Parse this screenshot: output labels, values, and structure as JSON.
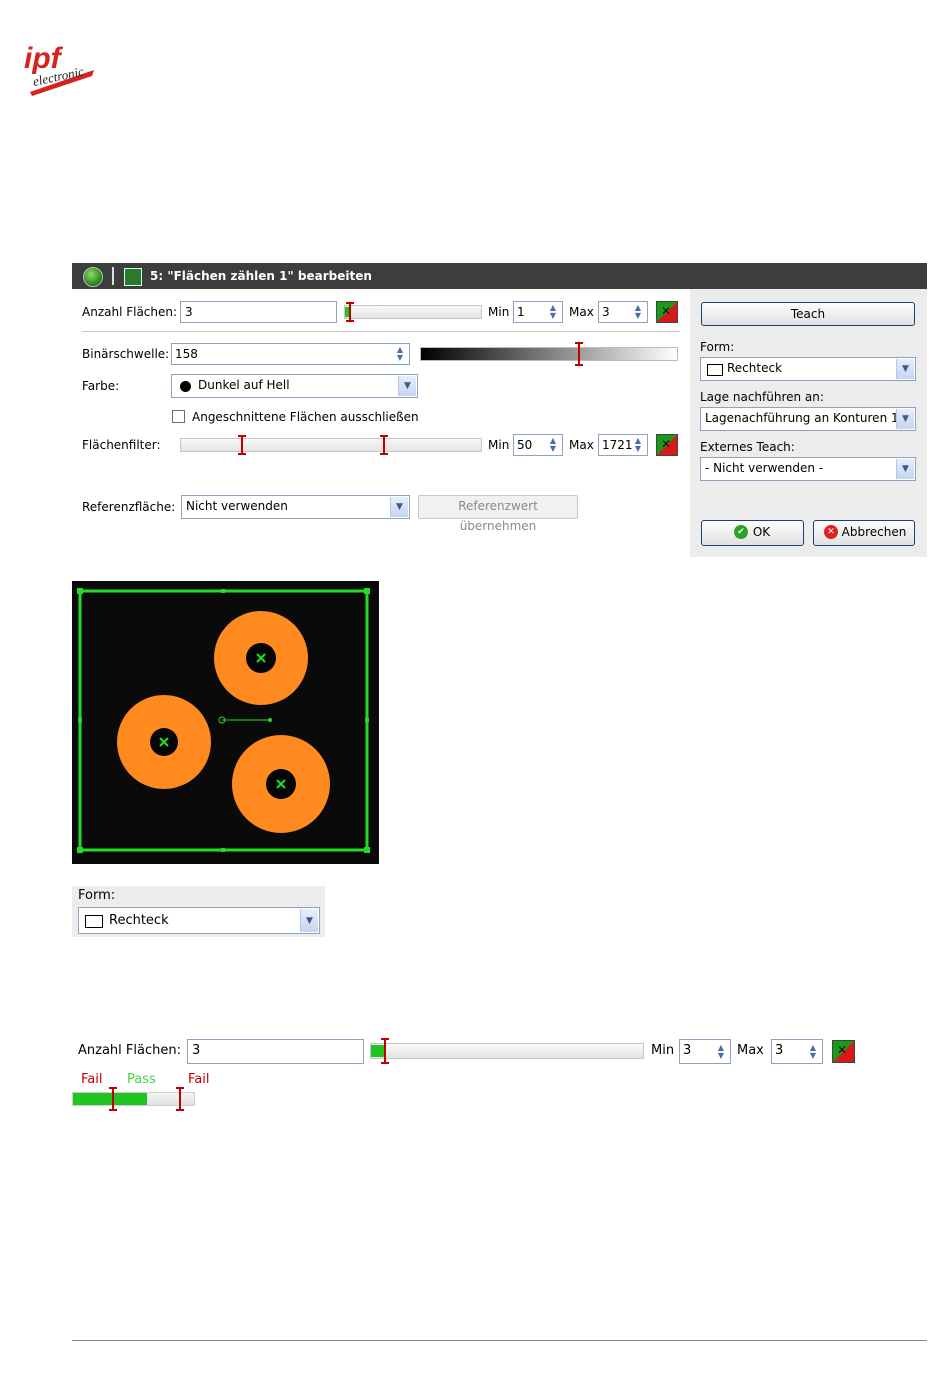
{
  "logo": {
    "text_top": "ipf",
    "text_bottom": "electronic"
  },
  "dialog": {
    "title": "5: \"Flächen zählen 1\" bearbeiten",
    "anzahl": {
      "label": "Anzahl Flächen:",
      "value": "3",
      "min_label": "Min",
      "min_value": "1",
      "max_label": "Max",
      "max_value": "3"
    },
    "binaer": {
      "label": "Binärschwelle:",
      "value": "158"
    },
    "farbe": {
      "label": "Farbe:",
      "value": "Dunkel auf Hell"
    },
    "angeschnitten": {
      "label": "Angeschnittene Flächen ausschließen",
      "checked": false
    },
    "flaechenfilter": {
      "label": "Flächenfilter:",
      "min_label": "Min",
      "min_value": "50",
      "max_label": "Max",
      "max_value": "1721"
    },
    "referenz": {
      "label": "Referenzfläche:",
      "value": "Nicht verwenden",
      "button": "Referenzwert übernehmen"
    },
    "right": {
      "teach": "Teach",
      "form_label": "Form:",
      "form_value": "Rechteck",
      "lage_label": "Lage nachführen an:",
      "lage_value": "Lagenachführung an Konturen 1",
      "extern_label": "Externes Teach:",
      "extern_value": "- Nicht verwenden -",
      "ok": "OK",
      "cancel": "Abbrechen"
    }
  },
  "form_crop": {
    "label": "Form:",
    "value": "Rechteck"
  },
  "anzahl_crop": {
    "label": "Anzahl Flächen:",
    "value": "3",
    "min_label": "Min",
    "min_value": "3",
    "max_label": "Max",
    "max_value": "3"
  },
  "legend": {
    "fail_left": "Fail",
    "pass": "Pass",
    "fail_right": "Fail"
  },
  "colors": {
    "titlebar": "#3d3d3d",
    "orange": "#ff8a1f",
    "green": "#22dd22",
    "fail": "#c00000",
    "pass": "#44d644"
  }
}
